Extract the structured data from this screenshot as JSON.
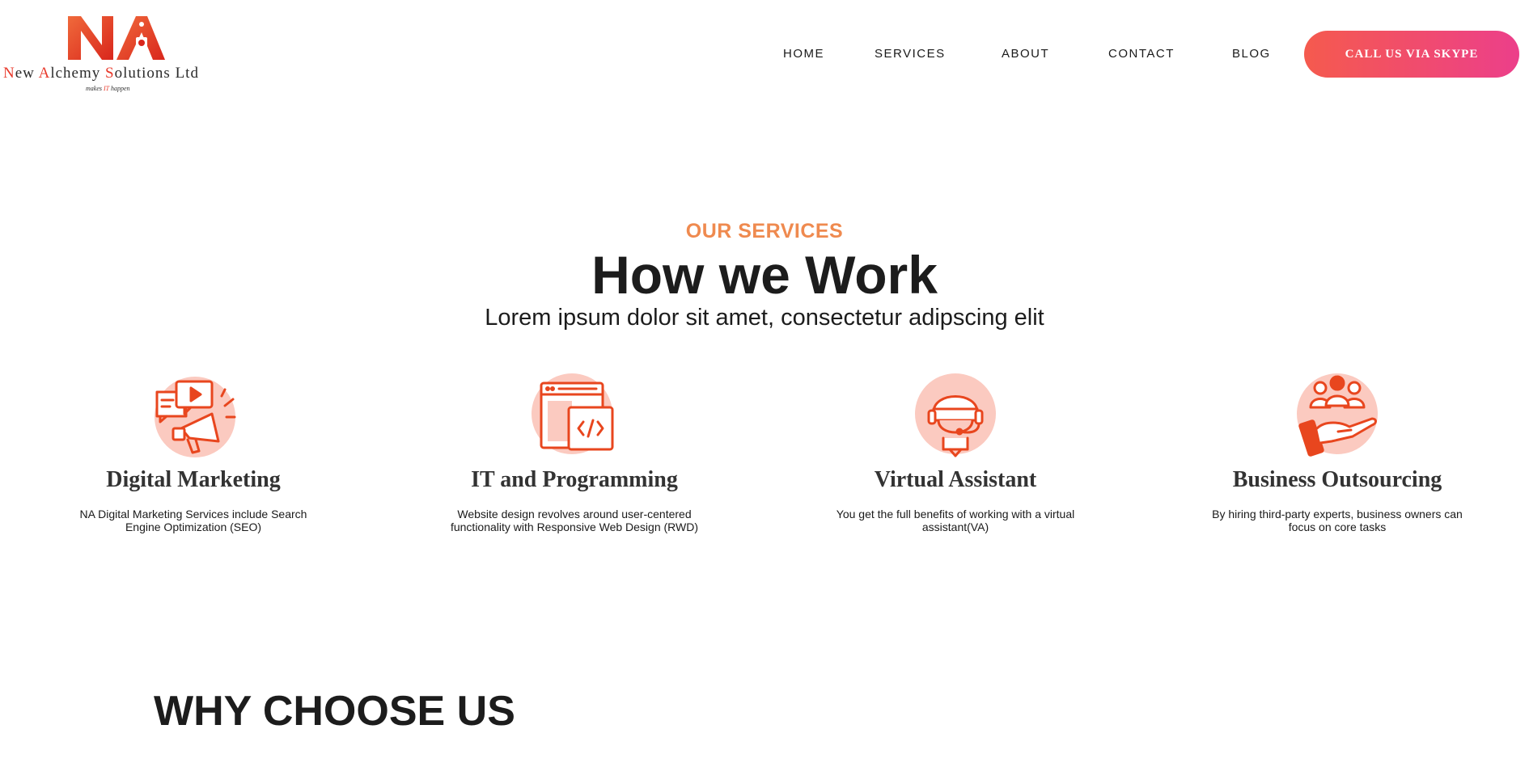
{
  "brand": {
    "mark_text": "NA",
    "name_parts": [
      {
        "text": "N",
        "hl": true
      },
      {
        "text": "ew ",
        "hl": false
      },
      {
        "text": "A",
        "hl": true
      },
      {
        "text": "lchemy ",
        "hl": false
      },
      {
        "text": "S",
        "hl": true
      },
      {
        "text": "olutions Ltd",
        "hl": false
      }
    ],
    "tagline_before": "makes ",
    "tagline_hl": "IT",
    "tagline_after": " happen",
    "colors": {
      "accent": "#e8392b",
      "text": "#2b2b2b"
    }
  },
  "nav": {
    "items": [
      "HOME",
      "SERVICES",
      "ABOUT",
      "CONTACT",
      "BLOG"
    ],
    "cta_label": "CALL US VIA SKYPE"
  },
  "services": {
    "eyebrow": "OUR SERVICES",
    "title": "How we Work",
    "subtitle": "Lorem ipsum dolor sit amet, consectetur adipscing elit",
    "cards": [
      {
        "icon": "megaphone-icon",
        "title": "Digital Marketing",
        "desc": "NA Digital Marketing Services include Search Engine Optimization (SEO)"
      },
      {
        "icon": "code-window-icon",
        "title": "IT and Programming",
        "desc": "Website design revolves around user-centered functionality with Responsive Web Design (RWD)"
      },
      {
        "icon": "headset-assistant-icon",
        "title": "Virtual Assistant",
        "desc": "You get the full benefits of working with a virtual assistant(VA)"
      },
      {
        "icon": "outsourcing-hand-icon",
        "title": "Business Outsourcing",
        "desc": "By hiring third-party experts, business owners can focus on core tasks"
      }
    ]
  },
  "why": {
    "title": "WHY CHOOSE US"
  },
  "colors": {
    "eyebrow": "#ef8a4f",
    "icon_stroke": "#e8461e",
    "icon_bg": "#fbcac0",
    "cta_gradient": [
      "#f55a4e",
      "#ec3f8a"
    ]
  }
}
